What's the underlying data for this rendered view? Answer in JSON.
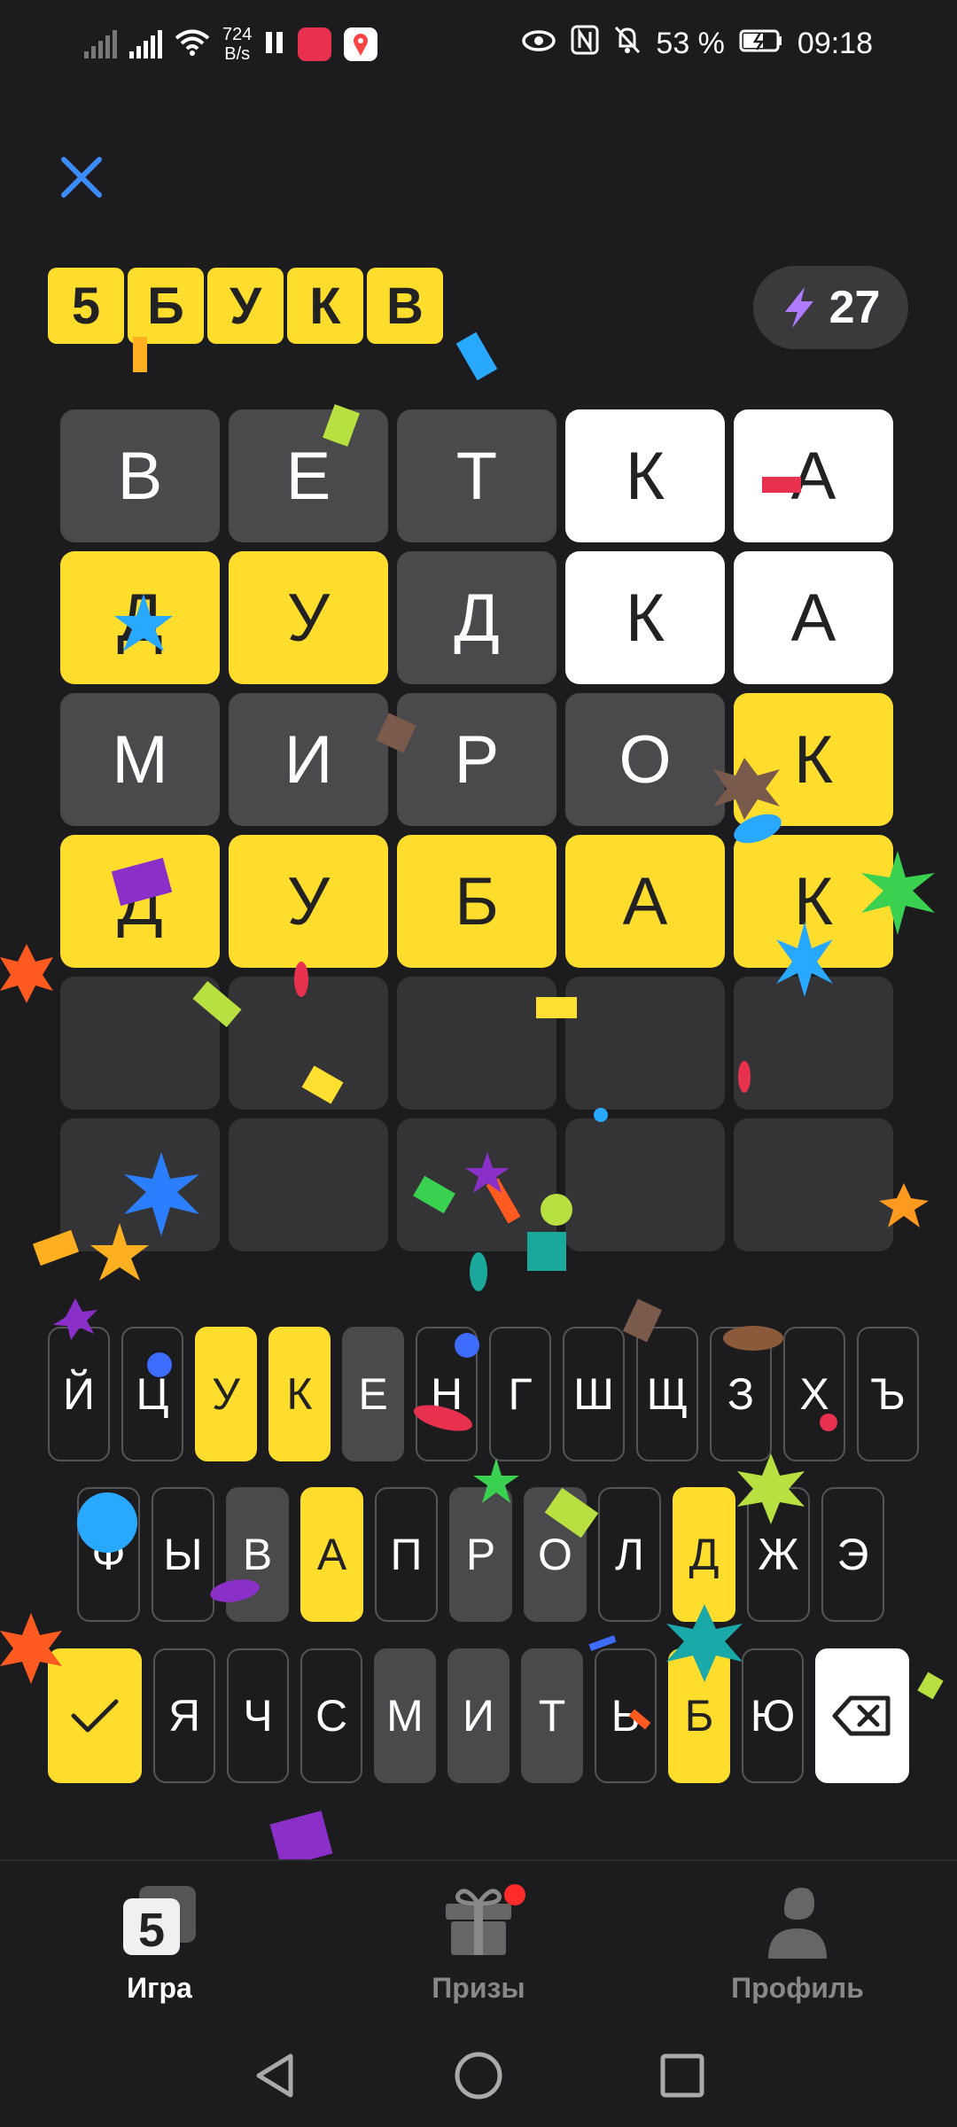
{
  "status_bar": {
    "net_speed_value": "724",
    "net_speed_unit": "B/s",
    "battery": "53 %",
    "time": "09:18",
    "icons": [
      "signal-off-icon",
      "4g-signal-icon",
      "wifi-icon",
      "pause-icon",
      "huawei-app-icon",
      "maps-app-icon",
      "eye-icon",
      "nfc-icon",
      "bell-off-icon",
      "battery-charging-icon"
    ]
  },
  "header": {
    "close_icon": "close-icon",
    "logo_letters": [
      "5",
      "Б",
      "У",
      "К",
      "В"
    ],
    "energy_count": "27",
    "energy_icon": "lightning-icon"
  },
  "board": {
    "rows": [
      [
        {
          "l": "В",
          "s": "absent"
        },
        {
          "l": "Е",
          "s": "absent"
        },
        {
          "l": "Т",
          "s": "absent"
        },
        {
          "l": "К",
          "s": "present"
        },
        {
          "l": "А",
          "s": "present"
        }
      ],
      [
        {
          "l": "Д",
          "s": "correct"
        },
        {
          "l": "У",
          "s": "correct"
        },
        {
          "l": "Д",
          "s": "absent"
        },
        {
          "l": "К",
          "s": "present"
        },
        {
          "l": "А",
          "s": "present"
        }
      ],
      [
        {
          "l": "М",
          "s": "absent"
        },
        {
          "l": "И",
          "s": "absent"
        },
        {
          "l": "Р",
          "s": "absent"
        },
        {
          "l": "О",
          "s": "absent"
        },
        {
          "l": "К",
          "s": "correct"
        }
      ],
      [
        {
          "l": "Д",
          "s": "correct"
        },
        {
          "l": "У",
          "s": "correct"
        },
        {
          "l": "Б",
          "s": "correct"
        },
        {
          "l": "А",
          "s": "correct"
        },
        {
          "l": "К",
          "s": "correct"
        }
      ],
      [
        {
          "l": "",
          "s": "empty"
        },
        {
          "l": "",
          "s": "empty"
        },
        {
          "l": "",
          "s": "empty"
        },
        {
          "l": "",
          "s": "empty"
        },
        {
          "l": "",
          "s": "empty"
        }
      ],
      [
        {
          "l": "",
          "s": "empty"
        },
        {
          "l": "",
          "s": "empty"
        },
        {
          "l": "",
          "s": "empty"
        },
        {
          "l": "",
          "s": "empty"
        },
        {
          "l": "",
          "s": "empty"
        }
      ]
    ]
  },
  "keyboard": {
    "rows": [
      [
        {
          "l": "Й",
          "s": ""
        },
        {
          "l": "Ц",
          "s": ""
        },
        {
          "l": "У",
          "s": "hit"
        },
        {
          "l": "К",
          "s": "hit"
        },
        {
          "l": "Е",
          "s": "used"
        },
        {
          "l": "Н",
          "s": ""
        },
        {
          "l": "Г",
          "s": ""
        },
        {
          "l": "Ш",
          "s": ""
        },
        {
          "l": "Щ",
          "s": ""
        },
        {
          "l": "З",
          "s": ""
        },
        {
          "l": "Х",
          "s": ""
        },
        {
          "l": "Ъ",
          "s": ""
        }
      ],
      [
        {
          "l": "Ф",
          "s": ""
        },
        {
          "l": "Ы",
          "s": ""
        },
        {
          "l": "В",
          "s": "used"
        },
        {
          "l": "А",
          "s": "hit"
        },
        {
          "l": "П",
          "s": ""
        },
        {
          "l": "Р",
          "s": "used"
        },
        {
          "l": "О",
          "s": "used"
        },
        {
          "l": "Л",
          "s": ""
        },
        {
          "l": "Д",
          "s": "hit"
        },
        {
          "l": "Ж",
          "s": ""
        },
        {
          "l": "Э",
          "s": ""
        }
      ],
      [
        {
          "l": "",
          "s": "enter"
        },
        {
          "l": "Я",
          "s": ""
        },
        {
          "l": "Ч",
          "s": ""
        },
        {
          "l": "С",
          "s": ""
        },
        {
          "l": "М",
          "s": "used"
        },
        {
          "l": "И",
          "s": "used"
        },
        {
          "l": "Т",
          "s": "used"
        },
        {
          "l": "Ь",
          "s": ""
        },
        {
          "l": "Б",
          "s": "hit"
        },
        {
          "l": "Ю",
          "s": ""
        },
        {
          "l": "",
          "s": "bksp"
        }
      ]
    ],
    "enter_icon": "check-icon",
    "backspace_icon": "backspace-icon"
  },
  "bottom_nav": [
    {
      "label": "Игра",
      "icon": "game-5-icon",
      "active": true
    },
    {
      "label": "Призы",
      "icon": "gift-icon",
      "active": false,
      "badge": true
    },
    {
      "label": "Профиль",
      "icon": "profile-icon",
      "active": false
    }
  ],
  "system_nav": [
    "back-icon",
    "home-icon",
    "recents-icon"
  ]
}
